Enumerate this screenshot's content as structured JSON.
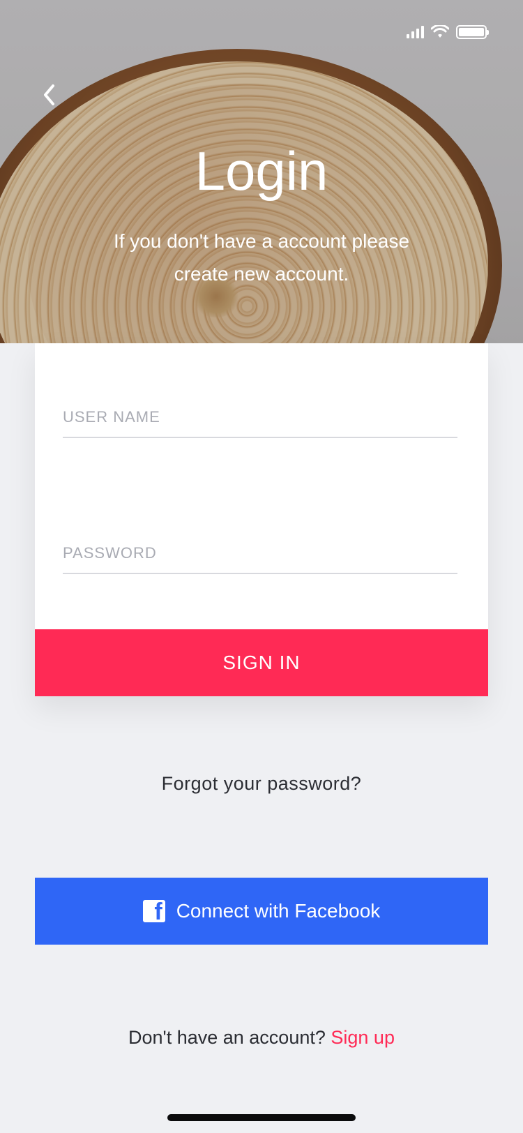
{
  "header": {
    "title": "Login",
    "subtitle": "If you don't have a account please\ncreate new account."
  },
  "status_bar": {
    "icons": [
      "signal-icon",
      "wifi-icon",
      "battery-icon"
    ]
  },
  "back_icon": "chevron-left-icon",
  "form": {
    "username_placeholder": "USER NAME",
    "username_value": "",
    "password_placeholder": "PASSWORD",
    "password_value": "",
    "sign_in_label": "SIGN IN"
  },
  "forgot_password": "Forgot your password?",
  "facebook": {
    "label": "Connect with Facebook",
    "icon": "facebook-icon"
  },
  "signup": {
    "prompt": "Don't have an account?",
    "link": "Sign up"
  },
  "colors": {
    "accent": "#ff2a55",
    "facebook": "#2f66f6",
    "background": "#eff0f3"
  }
}
